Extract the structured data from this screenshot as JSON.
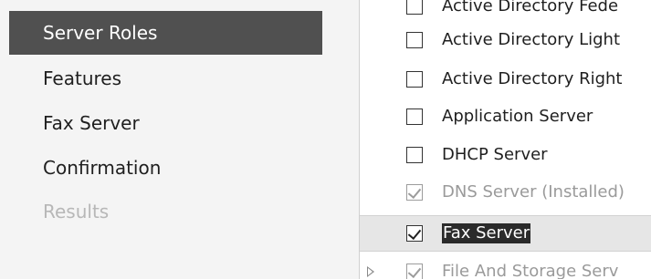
{
  "navigation": {
    "items": [
      {
        "label": "Server Roles",
        "selected": true,
        "enabled": true
      },
      {
        "label": "Features",
        "selected": false,
        "enabled": true
      },
      {
        "label": "Fax Server",
        "selected": false,
        "enabled": true
      },
      {
        "label": "Confirmation",
        "selected": false,
        "enabled": true
      },
      {
        "label": "Results",
        "selected": false,
        "enabled": false
      }
    ]
  },
  "roles": {
    "items": [
      {
        "label": "Active Directory Fede",
        "checked": false,
        "enabled": true
      },
      {
        "label": "Active Directory Light",
        "checked": false,
        "enabled": true
      },
      {
        "label": "Active Directory Right",
        "checked": false,
        "enabled": true
      },
      {
        "label": "Application Server",
        "checked": false,
        "enabled": true
      },
      {
        "label": "DHCP Server",
        "checked": false,
        "enabled": true
      },
      {
        "label": "DNS Server (Installed)",
        "checked": true,
        "enabled": false
      },
      {
        "label": "Fax Server",
        "checked": true,
        "enabled": true,
        "focused": true
      },
      {
        "label": "File And Storage Serv",
        "checked": true,
        "enabled": false,
        "expandable": true
      }
    ]
  },
  "colors": {
    "selected_nav_background": "#505050",
    "row_highlight": "#e6e6e6",
    "focused_label_background": "#2b2b2b"
  }
}
